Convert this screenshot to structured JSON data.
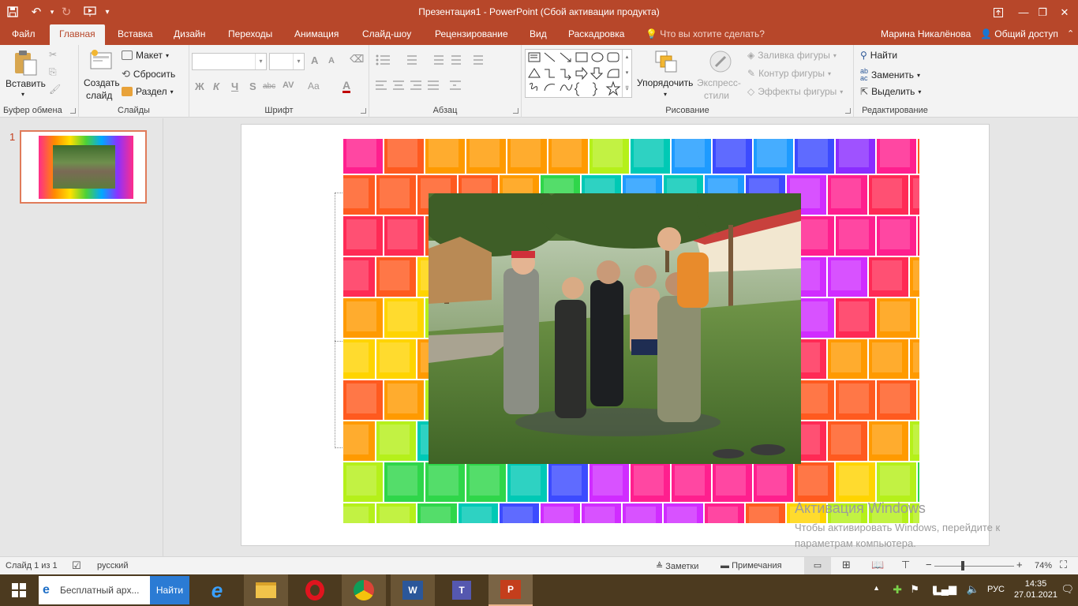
{
  "window": {
    "title": "Презентация1 - PowerPoint (Сбой активации продукта)"
  },
  "tabs": [
    {
      "label": "Файл"
    },
    {
      "label": "Главная"
    },
    {
      "label": "Вставка"
    },
    {
      "label": "Дизайн"
    },
    {
      "label": "Переходы"
    },
    {
      "label": "Анимация"
    },
    {
      "label": "Слайд-шоу"
    },
    {
      "label": "Рецензирование"
    },
    {
      "label": "Вид"
    },
    {
      "label": "Раскадровка"
    }
  ],
  "tell_me": "Что вы хотите сделать?",
  "user_name": "Марина Никалёнова",
  "share_label": "Общий доступ",
  "ribbon": {
    "clipboard": {
      "paste": "Вставить",
      "group": "Буфер обмена"
    },
    "slides": {
      "new_slide_line1": "Создать",
      "new_slide_line2": "слайд",
      "layout": "Макет",
      "reset": "Сбросить",
      "section": "Раздел",
      "group": "Слайды"
    },
    "font": {
      "bold": "Ж",
      "italic": "К",
      "underline": "Ч",
      "shadow": "S",
      "strike": "abc",
      "spacing": "AV",
      "case": "Aa",
      "color": "A",
      "grow": "A",
      "shrink": "A",
      "group": "Шрифт"
    },
    "paragraph": {
      "group": "Абзац"
    },
    "drawing": {
      "arrange": "Упорядочить",
      "styles_line1": "Экспресс-",
      "styles_line2": "стили",
      "fill": "Заливка фигуры",
      "outline": "Контур фигуры",
      "effects": "Эффекты фигуры",
      "group": "Рисование"
    },
    "editing": {
      "find": "Найти",
      "replace": "Заменить",
      "select": "Выделить",
      "group": "Редактирование"
    }
  },
  "slide_panel": {
    "number": "1"
  },
  "watermark": {
    "title": "Активация Windows",
    "line1": "Чтобы активировать Windows, перейдите к",
    "line2": "параметрам компьютера."
  },
  "status": {
    "slide": "Слайд 1 из 1",
    "language": "русский",
    "notes": "Заметки",
    "comments": "Примечания",
    "zoom": "74%",
    "zoom_minus": "−",
    "zoom_plus": "+"
  },
  "taskbar": {
    "search_text": "Бесплатный арх...",
    "search_button": "Найти",
    "lang": "РУС",
    "time": "14:35",
    "date": "27.01.2021"
  },
  "colors": {
    "accent": "#b7472a",
    "ribbon_bg": "#f3f3f3",
    "taskbar_bg": "#4c3a1f"
  }
}
